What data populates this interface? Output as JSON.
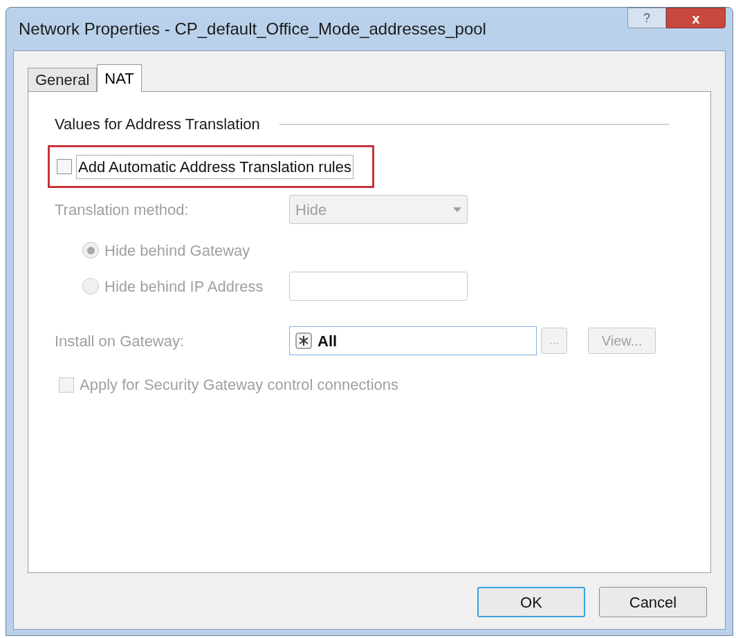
{
  "window": {
    "title": "Network Properties - CP_default_Office_Mode_addresses_pool",
    "help_button": "?",
    "close_button": "x"
  },
  "tabs": [
    {
      "label": "General",
      "selected": false
    },
    {
      "label": "NAT",
      "selected": true
    }
  ],
  "group": {
    "title": "Values for Address Translation"
  },
  "auto_rules": {
    "label": "Add Automatic Address Translation rules",
    "checked": false,
    "highlighted": true,
    "focused": true
  },
  "translation_method": {
    "label": "Translation method:",
    "value": "Hide",
    "disabled": true
  },
  "hide_options": [
    {
      "label": "Hide behind Gateway",
      "selected": true,
      "disabled": true
    },
    {
      "label": "Hide behind IP Address",
      "selected": false,
      "disabled": true
    }
  ],
  "install_on_gateway": {
    "label": "Install on Gateway:",
    "value": "All",
    "disabled": true,
    "browse_button": "...",
    "view_button": "View..."
  },
  "apply_control": {
    "label": "Apply for Security Gateway control connections",
    "checked": false,
    "disabled": true
  },
  "buttons": [
    {
      "label": "OK",
      "default": true
    },
    {
      "label": "Cancel",
      "default": false
    }
  ]
}
